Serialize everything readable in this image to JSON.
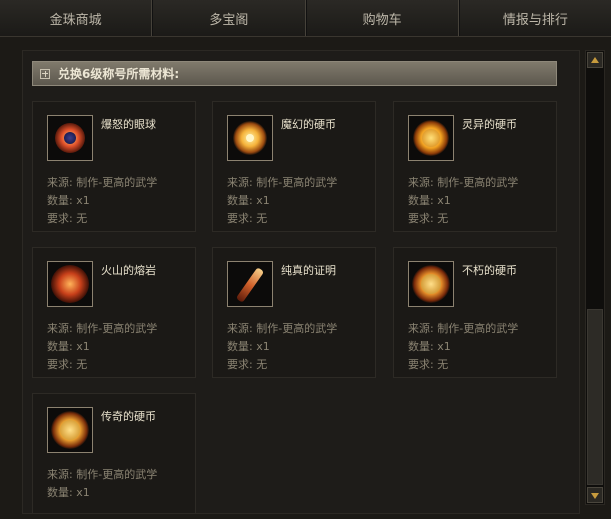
{
  "tabs": [
    {
      "label": "金珠商城"
    },
    {
      "label": "多宝阁"
    },
    {
      "label": "购物车"
    },
    {
      "label": "情报与排行"
    }
  ],
  "section": {
    "title": "兑换6级称号所需材料:"
  },
  "labels": {
    "source": "来源:",
    "quantity": "数量:",
    "requirement": "要求:"
  },
  "items": [
    {
      "name": "爆怒的眼球",
      "icon": "eyeball-icon",
      "source": "制作-更高的武学",
      "quantity": "x1",
      "requirement": "无"
    },
    {
      "name": "魔幻的硬币",
      "icon": "magic-coin-icon",
      "source": "制作-更高的武学",
      "quantity": "x1",
      "requirement": "无"
    },
    {
      "name": "灵异的硬币",
      "icon": "spirit-coin-icon",
      "source": "制作-更高的武学",
      "quantity": "x1",
      "requirement": "无"
    },
    {
      "name": "火山的熔岩",
      "icon": "lava-icon",
      "source": "制作-更高的武学",
      "quantity": "x1",
      "requirement": "无"
    },
    {
      "name": "纯真的证明",
      "icon": "proof-icon",
      "source": "制作-更高的武学",
      "quantity": "x1",
      "requirement": "无"
    },
    {
      "name": "不朽的硬币",
      "icon": "immortal-coin-icon",
      "source": "制作-更高的武学",
      "quantity": "x1",
      "requirement": "无"
    },
    {
      "name": "传奇的硬币",
      "icon": "legend-coin-icon",
      "source": "制作-更高的武学",
      "quantity": "x1",
      "requirement": ""
    }
  ],
  "colors": {
    "accent": "#c79b3d",
    "text": "#e8e1cc",
    "muted": "#8a8372"
  }
}
